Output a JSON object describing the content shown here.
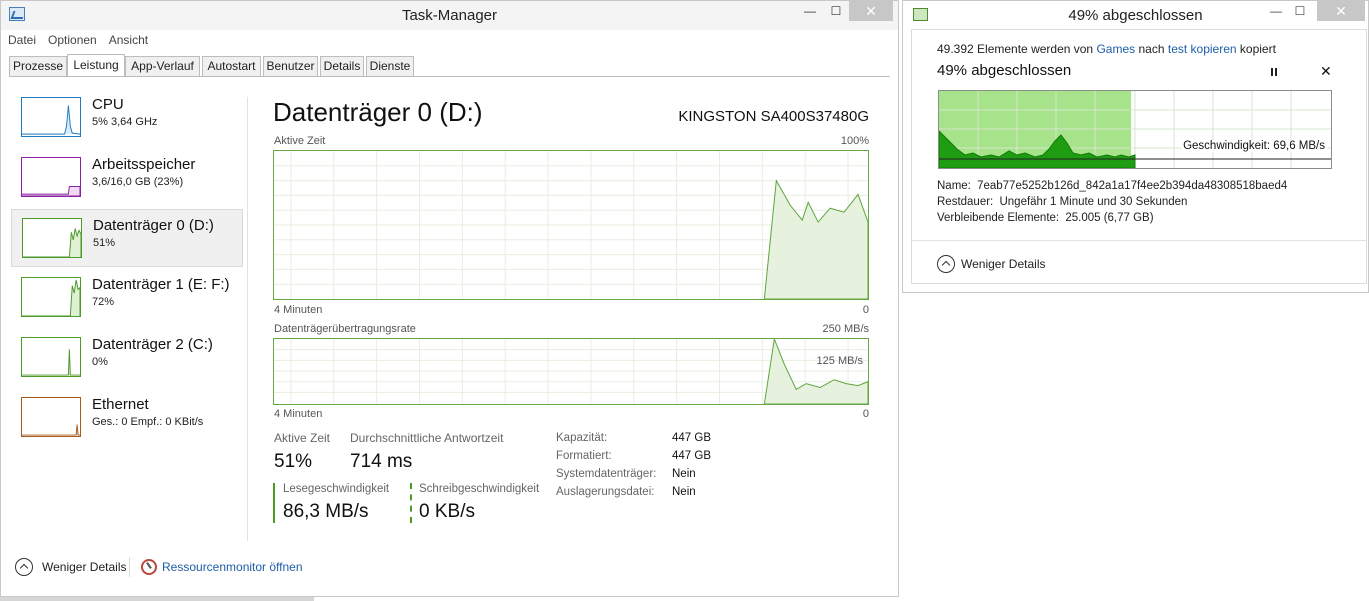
{
  "taskmanager": {
    "title": "Task-Manager",
    "window_buttons": {
      "minimize": "—",
      "maximize": "☐",
      "close": "✕"
    },
    "menu": [
      "Datei",
      "Optionen",
      "Ansicht"
    ],
    "tabs": [
      "Prozesse",
      "Leistung",
      "App-Verlauf",
      "Autostart",
      "Benutzer",
      "Details",
      "Dienste"
    ],
    "active_tab": "Leistung",
    "sidebar": [
      {
        "name": "CPU",
        "sub": "5%  3,64 GHz",
        "color": "#1f7bbf"
      },
      {
        "name": "Arbeitsspeicher",
        "sub": "3,6/16,0 GB (23%)",
        "color": "#8b22a3"
      },
      {
        "name": "Datenträger 0 (D:)",
        "sub": "51%",
        "color": "#4c9a2a"
      },
      {
        "name": "Datenträger 1 (E: F:)",
        "sub": "72%",
        "color": "#4c9a2a"
      },
      {
        "name": "Datenträger 2 (C:)",
        "sub": "0%",
        "color": "#4c9a2a"
      },
      {
        "name": "Ethernet",
        "sub": "Ges.: 0  Empf.: 0 KBit/s",
        "color": "#a75a1d"
      }
    ],
    "detail": {
      "title": "Datenträger 0 (D:)",
      "model": "KINGSTON SA400S37480G",
      "graph1": {
        "label": "Aktive Zeit",
        "max": "100%",
        "xleft": "4 Minuten",
        "xright": "0"
      },
      "graph2": {
        "label": "Datenträgerübertragungsrate",
        "max": "250 MB/s",
        "mid": "125 MB/s",
        "xleft": "4 Minuten",
        "xright": "0"
      },
      "stats": {
        "active_label": "Aktive Zeit",
        "active_value": "51%",
        "resp_label": "Durchschnittliche Antwortzeit",
        "resp_value": "714 ms",
        "read_label": "Lesegeschwindigkeit",
        "read_value": "86,3 MB/s",
        "write_label": "Schreibgeschwindigkeit",
        "write_value": "0 KB/s"
      },
      "props": [
        {
          "k": "Kapazität:",
          "v": "447 GB"
        },
        {
          "k": "Formatiert:",
          "v": "447 GB"
        },
        {
          "k": "Systemdatenträger:",
          "v": "Nein"
        },
        {
          "k": "Auslagerungsdatei:",
          "v": "Nein"
        }
      ]
    },
    "footer": {
      "less_details": "Weniger Details",
      "resmon": "Ressourcenmonitor öffnen"
    }
  },
  "copy": {
    "title": "49% abgeschlossen",
    "window_buttons": {
      "minimize": "—",
      "maximize": "☐",
      "close": "✕"
    },
    "line_items": "49.392 Elemente werden von",
    "line_from": "Games",
    "line_mid": "nach",
    "line_to": "test kopieren",
    "line_end": "kopiert",
    "progress_text": "49% abgeschlossen",
    "progress_percent": 49,
    "speed": "Geschwindigkeit: 69,6 MB/s",
    "name_label": "Name:",
    "name_value": "7eab77e5252b126d_842a1a17f4ee2b394da48308518baed4",
    "rest_label": "Restdauer:",
    "rest_value": "Ungefähr 1 Minute und 30 Sekunden",
    "remain_label": "Verbleibende Elemente:",
    "remain_value": "25.005 (6,77 GB)",
    "less_details": "Weniger Details"
  }
}
